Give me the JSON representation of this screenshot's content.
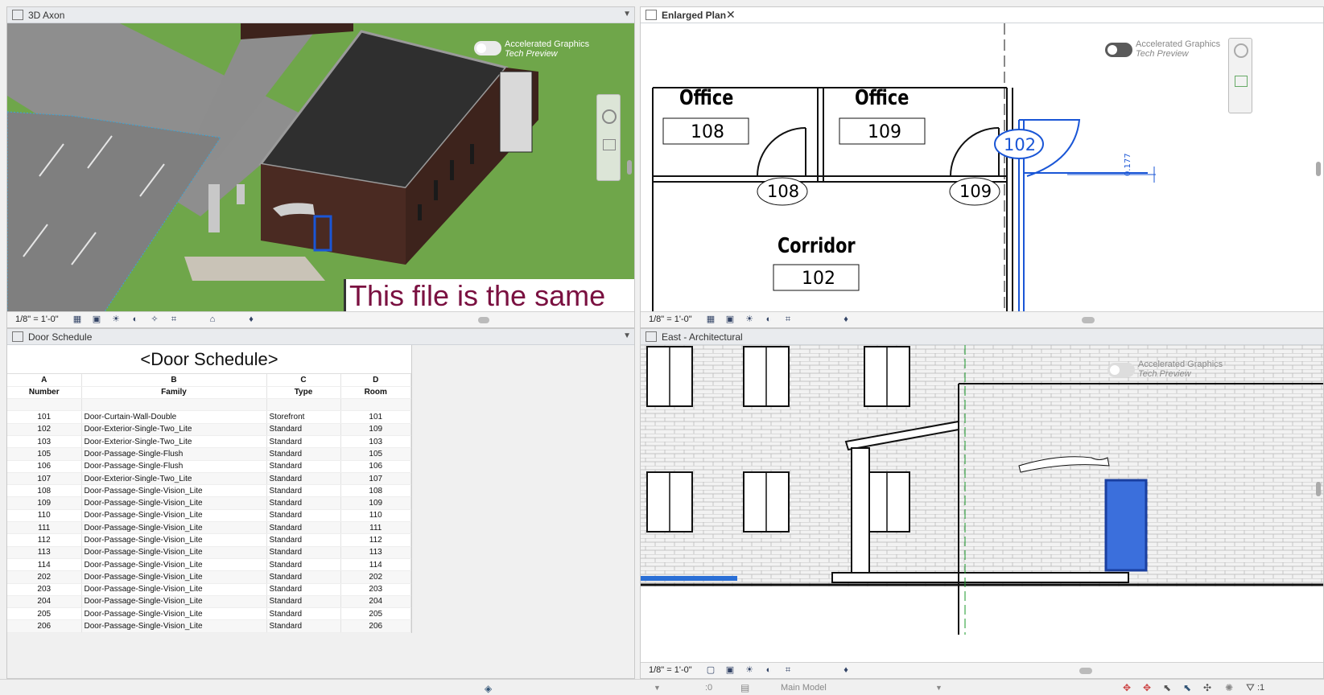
{
  "views": {
    "axon": {
      "title": "3D Axon",
      "overlay_text": "This file is the same",
      "accel_line1": "Accelerated Graphics",
      "accel_line2": "Tech Preview",
      "scale": "1/8\" = 1'-0\""
    },
    "plan": {
      "title": "Enlarged Plan",
      "accel_line1": "Accelerated Graphics",
      "accel_line2": "Tech Preview",
      "scale": "1/8\" = 1'-0\"",
      "rooms": [
        {
          "name": "Office",
          "number": "108"
        },
        {
          "name": "Office",
          "number": "109"
        },
        {
          "name": "Corridor",
          "number": "102"
        }
      ],
      "door_tags": [
        "108",
        "109",
        "102"
      ],
      "dimension": "0.177"
    },
    "schedule": {
      "title": "Door Schedule",
      "sched_title": "<Door Schedule>",
      "column_letters": [
        "A",
        "B",
        "C",
        "D"
      ],
      "columns": [
        "Number",
        "Family",
        "Type",
        "Room"
      ],
      "rows": [
        [
          "101",
          "Door-Curtain-Wall-Double",
          "Storefront",
          "101"
        ],
        [
          "102",
          "Door-Exterior-Single-Two_Lite",
          "Standard",
          "109"
        ],
        [
          "103",
          "Door-Exterior-Single-Two_Lite",
          "Standard",
          "103"
        ],
        [
          "105",
          "Door-Passage-Single-Flush",
          "Standard",
          "105"
        ],
        [
          "106",
          "Door-Passage-Single-Flush",
          "Standard",
          "106"
        ],
        [
          "107",
          "Door-Exterior-Single-Two_Lite",
          "Standard",
          "107"
        ],
        [
          "108",
          "Door-Passage-Single-Vision_Lite",
          "Standard",
          "108"
        ],
        [
          "109",
          "Door-Passage-Single-Vision_Lite",
          "Standard",
          "109"
        ],
        [
          "110",
          "Door-Passage-Single-Vision_Lite",
          "Standard",
          "110"
        ],
        [
          "111",
          "Door-Passage-Single-Vision_Lite",
          "Standard",
          "111"
        ],
        [
          "112",
          "Door-Passage-Single-Vision_Lite",
          "Standard",
          "112"
        ],
        [
          "113",
          "Door-Passage-Single-Vision_Lite",
          "Standard",
          "113"
        ],
        [
          "114",
          "Door-Passage-Single-Vision_Lite",
          "Standard",
          "114"
        ],
        [
          "202",
          "Door-Passage-Single-Vision_Lite",
          "Standard",
          "202"
        ],
        [
          "203",
          "Door-Passage-Single-Vision_Lite",
          "Standard",
          "203"
        ],
        [
          "204",
          "Door-Passage-Single-Vision_Lite",
          "Standard",
          "204"
        ],
        [
          "205",
          "Door-Passage-Single-Vision_Lite",
          "Standard",
          "205"
        ],
        [
          "206",
          "Door-Passage-Single-Vision_Lite",
          "Standard",
          "206"
        ]
      ]
    },
    "elevation": {
      "title": "East - Architectural",
      "accel_line1": "Accelerated Graphics",
      "accel_line2": "Tech Preview",
      "scale": "1/8\" = 1'-0\""
    }
  },
  "status_bar": {
    "workset_count": ":0",
    "model_label": "Main Model",
    "filter_count": ":1"
  },
  "colors": {
    "grass": "#6fa64a",
    "brick": "#4a2a22",
    "selection_blue": "#1a56d6",
    "overlay_text": "#7a1040"
  }
}
